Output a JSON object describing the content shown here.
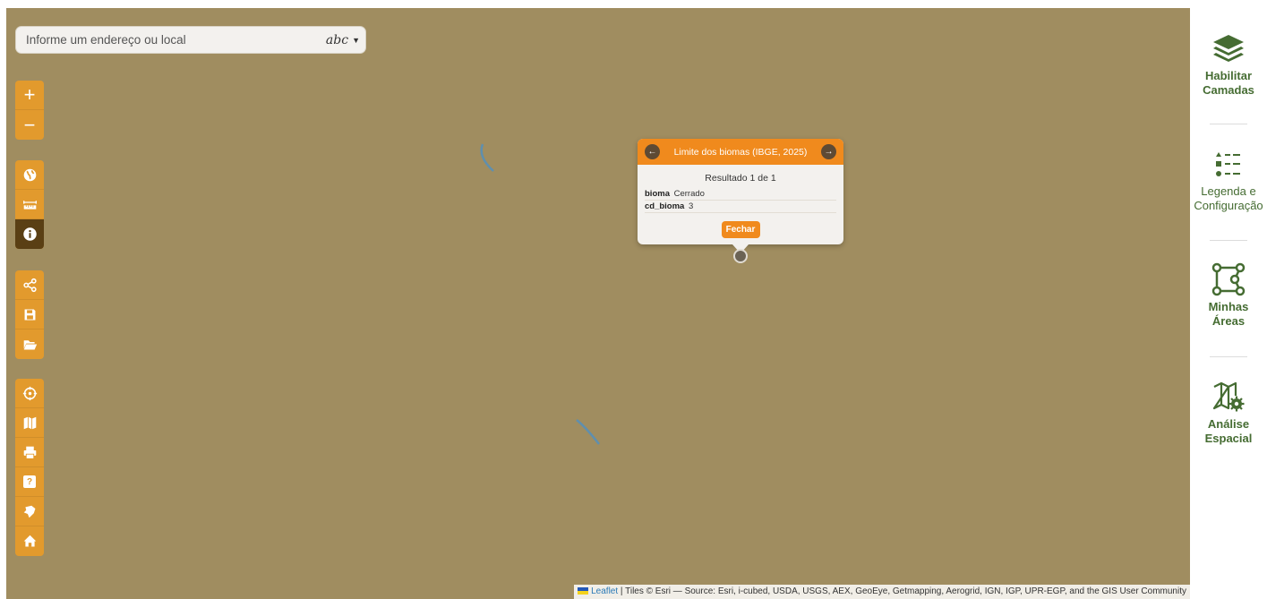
{
  "search": {
    "placeholder": "Informe um endereço ou local",
    "mode_label": "abc"
  },
  "map_controls": {
    "zoom": [
      "zoom-in",
      "zoom-out"
    ],
    "tools": [
      "globe-icon",
      "ruler-icon",
      "info-icon"
    ],
    "file": [
      "share-icon",
      "save-icon",
      "folder-open-icon"
    ],
    "misc": [
      "locate-icon",
      "map-icon",
      "print-icon",
      "help-icon",
      "region-icon",
      "home-icon"
    ],
    "zoom_in_label": "+",
    "zoom_out_label": "−",
    "help_label": "?"
  },
  "popup": {
    "title": "Limite dos biomas (IBGE, 2025)",
    "result": "Resultado 1 de 1",
    "fields": [
      {
        "key": "bioma",
        "value": "Cerrado"
      },
      {
        "key": "cd_bioma",
        "value": "3"
      }
    ],
    "close_label": "Fechar"
  },
  "attribution": {
    "leaflet": "Leaflet",
    "text": " | Tiles © Esri — Source: Esri, i-cubed, USDA, USGS, AEX, GeoEye, Getmapping, Aerogrid, IGN, IGP, UPR-EGP, and the GIS User Community"
  },
  "right_panel": {
    "items": [
      {
        "line1": "Habilitar",
        "line2": "Camadas",
        "icon": "layers-icon"
      },
      {
        "line1": "Legenda e",
        "line2": "Configuração",
        "icon": "legend-icon"
      },
      {
        "line1": "Minhas",
        "line2": "Áreas",
        "icon": "polygon-icon"
      },
      {
        "line1": "Análise",
        "line2": "Espacial",
        "icon": "map-gear-icon"
      }
    ]
  },
  "colors": {
    "map_background": "#a08d60",
    "control_orange": "#e29a2d",
    "control_active": "#5a3f14",
    "popup_header": "#f08a1d",
    "panel_green": "#456c32",
    "river_blue": "#5f8fae"
  }
}
